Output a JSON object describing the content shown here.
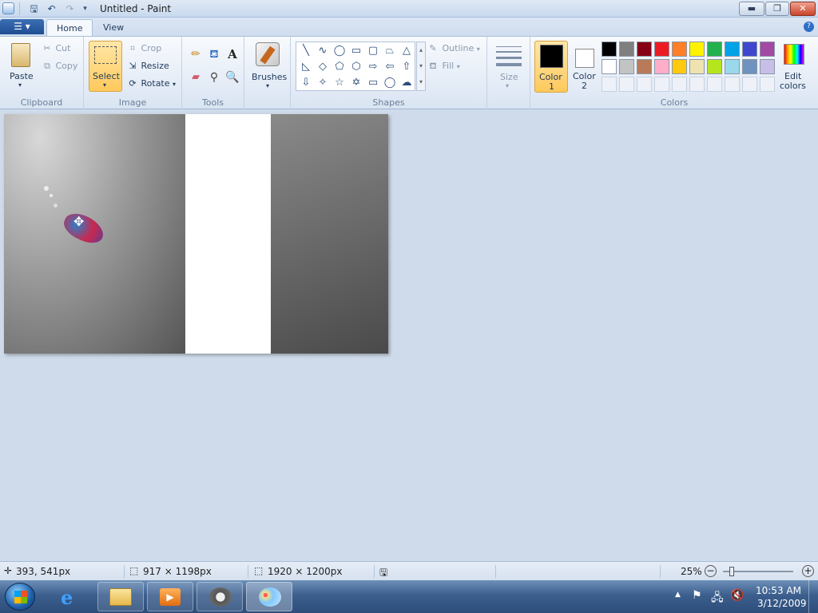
{
  "window": {
    "title": "Untitled - Paint",
    "min_label": "▬",
    "max_label": "❐",
    "close_label": "✕"
  },
  "tabs": {
    "home": "Home",
    "view": "View"
  },
  "clipboard": {
    "group_label": "Clipboard",
    "paste_label": "Paste",
    "cut_label": "Cut",
    "copy_label": "Copy"
  },
  "image": {
    "group_label": "Image",
    "select_label": "Select",
    "crop_label": "Crop",
    "resize_label": "Resize",
    "rotate_label": "Rotate"
  },
  "tools": {
    "group_label": "Tools"
  },
  "brushes": {
    "label": "Brushes"
  },
  "shapes": {
    "group_label": "Shapes",
    "outline_label": "Outline",
    "fill_label": "Fill",
    "items": [
      "╲",
      "∿",
      "◯",
      "▭",
      "▢",
      "⏢",
      "△",
      "◺",
      "◇",
      "⬠",
      "⬡",
      "⇨",
      "⇦",
      "⇧",
      "⇩",
      "✧",
      "☆",
      "✡",
      "▭",
      "◯",
      "☁"
    ]
  },
  "size": {
    "label": "Size"
  },
  "colors": {
    "group_label": "Colors",
    "color1_label": "Color",
    "color1_num": "1",
    "color2_label": "Color",
    "color2_num": "2",
    "edit_label": "Edit",
    "edit_label2": "colors",
    "color1_value": "#000000",
    "color2_value": "#ffffff",
    "palette_row1": [
      "#000000",
      "#7f7f7f",
      "#880015",
      "#ed1c24",
      "#ff7f27",
      "#fff200",
      "#22b14c",
      "#00a2e8",
      "#3f48cc",
      "#a349a4"
    ],
    "palette_row2": [
      "#ffffff",
      "#c3c3c3",
      "#b97a57",
      "#ffaec9",
      "#ffc90e",
      "#efe4b0",
      "#b5e61d",
      "#99d9ea",
      "#7092be",
      "#c8bfe7"
    ]
  },
  "status": {
    "cursor_pos": "393, 541px",
    "selection_size": "917 × 1198px",
    "image_size": "1920 × 1200px",
    "zoom": "25%"
  },
  "taskbar": {
    "time": "10:53 AM",
    "date": "3/12/2009"
  }
}
